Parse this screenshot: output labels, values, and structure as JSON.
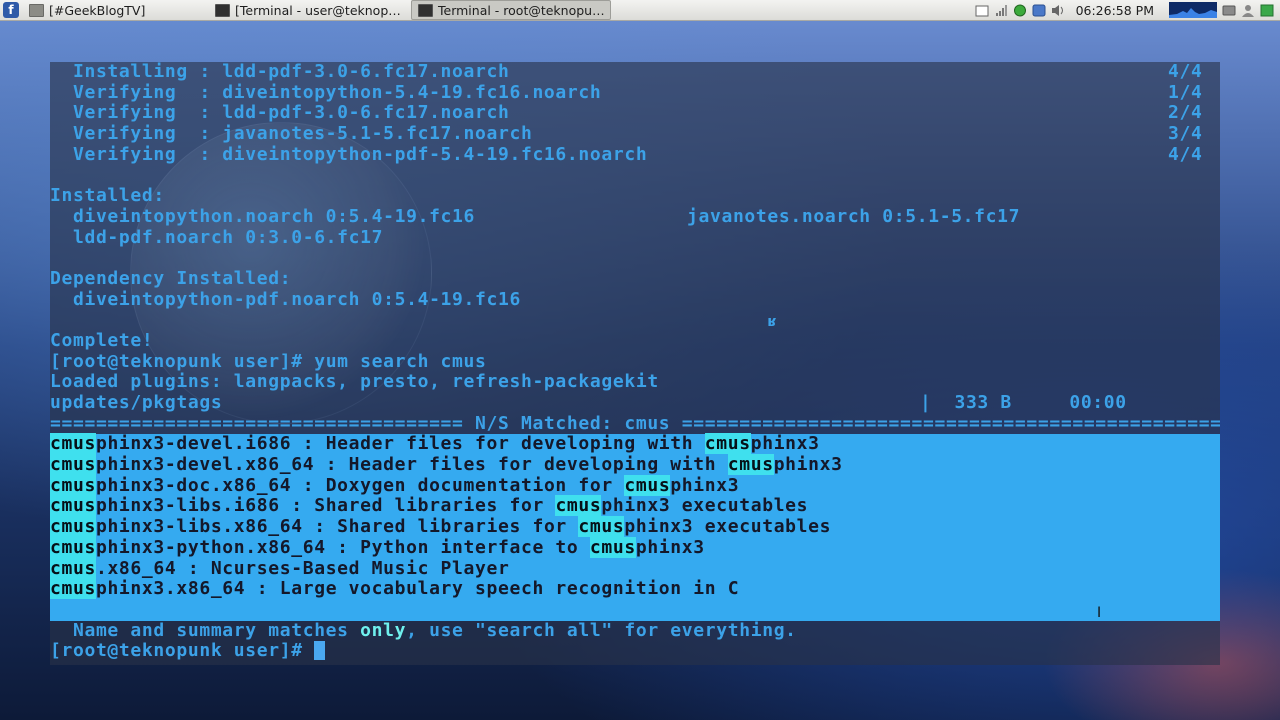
{
  "panel": {
    "tasks": [
      {
        "label": "[#GeekBlogTV]",
        "active": false
      },
      {
        "label": "[Terminal - user@teknop…",
        "active": false
      },
      {
        "label": "Terminal - root@teknopu…",
        "active": true
      }
    ],
    "clock": "06:26:58 PM"
  },
  "terminal": {
    "install_lines": [
      {
        "text": "  Installing : ldd-pdf-3.0-6.fc17.noarch",
        "right": "4/4"
      },
      {
        "text": "  Verifying  : diveintopython-5.4-19.fc16.noarch",
        "right": "1/4"
      },
      {
        "text": "  Verifying  : ldd-pdf-3.0-6.fc17.noarch",
        "right": "2/4"
      },
      {
        "text": "  Verifying  : javanotes-5.1-5.fc17.noarch",
        "right": "3/4"
      },
      {
        "text": "  Verifying  : diveintopython-pdf-5.4-19.fc16.noarch",
        "right": "4/4"
      }
    ],
    "installed_header": "Installed:",
    "installed_items": [
      {
        "col1": "  diveintopython.noarch 0:5.4-19.fc16",
        "col2": "javanotes.noarch 0:5.1-5.fc17"
      },
      {
        "col1": "  ldd-pdf.noarch 0:3.0-6.fc17",
        "col2": ""
      }
    ],
    "dep_header": "Dependency Installed:",
    "dep_items": [
      "  diveintopython-pdf.noarch 0:5.4-19.fc16"
    ],
    "complete": "Complete!",
    "prompt": "[root@teknopunk user]# ",
    "command": "yum search cmus",
    "plugins": "Loaded plugins: langpacks, presto, refresh-packagekit",
    "pkgtags": "updates/pkgtags",
    "pkgtags_bar": "|  333 B     00:00",
    "stray_char": "ʁ",
    "separator_title": " N/S Matched: cmus ",
    "results": [
      {
        "pre": "",
        "hl": "cmus",
        "rest": "phinx3-devel.i686 : Header files for developing with ",
        "hl2": "cmus",
        "tail": "phinx3"
      },
      {
        "pre": "",
        "hl": "cmus",
        "rest": "phinx3-devel.x86_64 : Header files for developing with ",
        "hl2": "cmus",
        "tail": "phinx3"
      },
      {
        "pre": "",
        "hl": "cmus",
        "rest": "phinx3-doc.x86_64 : Doxygen documentation for ",
        "hl2": "cmus",
        "tail": "phinx3"
      },
      {
        "pre": "",
        "hl": "cmus",
        "rest": "phinx3-libs.i686 : Shared libraries for ",
        "hl2": "cmus",
        "tail": "phinx3 executables"
      },
      {
        "pre": "",
        "hl": "cmus",
        "rest": "phinx3-libs.x86_64 : Shared libraries for ",
        "hl2": "cmus",
        "tail": "phinx3 executables"
      },
      {
        "pre": "",
        "hl": "cmus",
        "rest": "phinx3-python.x86_64 : Python interface to ",
        "hl2": "cmus",
        "tail": "phinx3"
      },
      {
        "pre": "",
        "hl": "cmus",
        "rest": ".x86_64 : Ncurses-Based Music Player",
        "hl2": "",
        "tail": ""
      },
      {
        "pre": "",
        "hl": "cmus",
        "rest": "phinx3.x86_64 : Large vocabulary speech recognition in C",
        "hl2": "",
        "tail": ""
      }
    ],
    "info_pre": "  Name and summary matches ",
    "info_only": "only",
    "info_post": ", use \"search all\" for everything.",
    "final_prompt": "[root@teknopunk user]# "
  }
}
